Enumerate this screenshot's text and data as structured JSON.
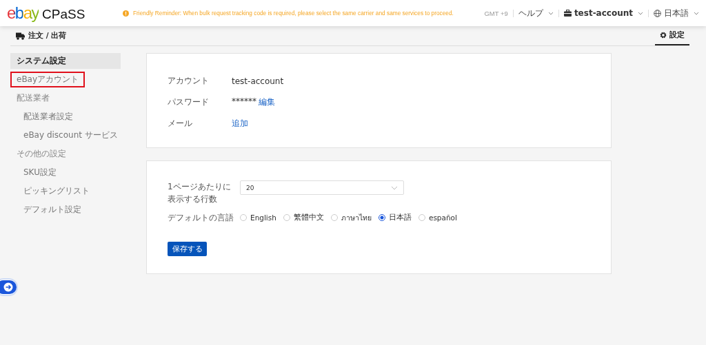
{
  "header": {
    "logo": {
      "ebay": "ebay",
      "product": "CPaSS"
    },
    "reminder": "Friendly Reminder: When bulk request tracking code is required, please select the same carrier and same services to proceed.",
    "timezone": "GMT +9",
    "help": "ヘルプ",
    "account": "test-account",
    "language": "日本語"
  },
  "subheader": {
    "section": "注文 / 出荷",
    "settings_tab": {
      "label": "設定",
      "selected": true
    }
  },
  "sidebar": {
    "items": [
      {
        "label": "システム設定",
        "selected": true,
        "highlighted": false
      },
      {
        "label": "eBayアカウント",
        "selected": false,
        "highlighted": true
      },
      {
        "label": "配送業者",
        "selected": false,
        "highlighted": false,
        "children": [
          {
            "label": "配送業者設定",
            "selected": false,
            "highlighted": false
          },
          {
            "label": "eBay discount サービス",
            "selected": false,
            "highlighted": false
          }
        ]
      },
      {
        "label": "その他の設定",
        "selected": false,
        "highlighted": false,
        "children": [
          {
            "label": "SKU設定",
            "selected": false,
            "highlighted": false
          },
          {
            "label": "ピッキングリスト",
            "selected": false,
            "highlighted": false
          },
          {
            "label": "デフォルト設定",
            "selected": false,
            "highlighted": false
          }
        ]
      }
    ]
  },
  "account_card": {
    "rows": [
      {
        "label": "アカウント",
        "value": "test-account"
      },
      {
        "label": "パスワード",
        "value": "******",
        "link": "編集"
      },
      {
        "label": "メール",
        "link": "追加"
      }
    ]
  },
  "prefs_card": {
    "rows_per_page": {
      "label": "1ページあたりに表示する行数",
      "value": "20"
    },
    "language": {
      "label": "デフォルトの言語",
      "options": [
        {
          "label": "English",
          "selected": false
        },
        {
          "label": "繁體中文",
          "selected": false
        },
        {
          "label": "ภาษาไทย",
          "selected": false
        },
        {
          "label": "日本語",
          "selected": true
        },
        {
          "label": "español",
          "selected": false
        }
      ]
    },
    "save_button": "保存する"
  }
}
